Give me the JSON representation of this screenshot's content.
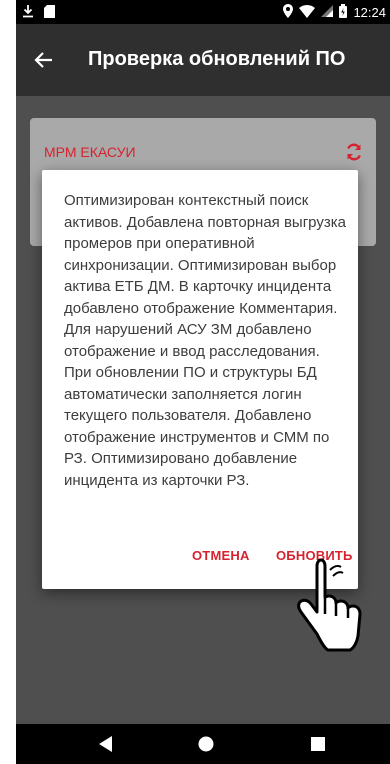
{
  "status_bar": {
    "time": "12:24",
    "left_icons": [
      "download-icon",
      "sd-card-icon"
    ],
    "right_icons": [
      "location-icon",
      "wifi-icon",
      "signal-icon",
      "battery-icon"
    ]
  },
  "app_bar": {
    "title": "Проверка обновлений ПО",
    "back_icon": "arrow-back-icon"
  },
  "card": {
    "title": "МРМ ЕКАСУИ",
    "action_icon": "sync-icon",
    "accent_color": "#d6232f"
  },
  "dialog": {
    "message": "Оптимизирован контекстный поиск активов. Добавлена повторная выгрузка промеров при оперативной синхронизации. Оптимизирован выбор актива ЕТБ ДМ. В карточку инцидента добавлено отображение Комментария. Для нарушений АСУ ЗМ добавлено отображение и ввод расследования. При обновлении ПО и структуры БД автоматически заполняется логин текущего пользователя. Добавлено отображение инструментов и СММ по РЗ. Оптимизировано добавление инцидента из карточки РЗ.",
    "cancel_label": "ОТМЕНА",
    "update_label": "ОБНОВИТЬ",
    "button_color": "#d6232f"
  },
  "nav_bar": {
    "icons": [
      "nav-back-icon",
      "nav-home-icon",
      "nav-recents-icon"
    ]
  }
}
